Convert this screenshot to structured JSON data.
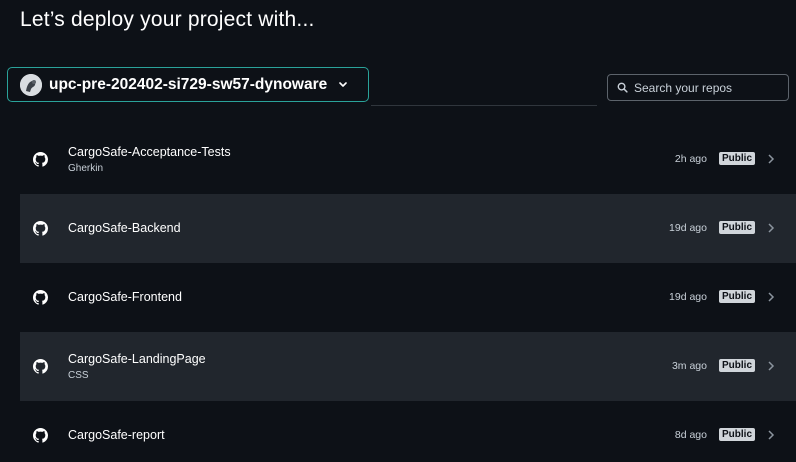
{
  "header": {
    "title": "Let’s deploy your project with..."
  },
  "account": {
    "name": "upc-pre-202402-si729-sw57-dynoware",
    "avatar_icon": "org-avatar",
    "dropdown_icon": "chevron-down-icon",
    "focus_color": "#2aa39a"
  },
  "search": {
    "placeholder": "Search your repos",
    "value": "",
    "icon": "search-icon"
  },
  "repos": [
    {
      "name": "CargoSafe-Acceptance-Tests",
      "language": "Gherkin",
      "updated": "2h ago",
      "visibility": "Public"
    },
    {
      "name": "CargoSafe-Backend",
      "language": "",
      "updated": "19d ago",
      "visibility": "Public"
    },
    {
      "name": "CargoSafe-Frontend",
      "language": "",
      "updated": "19d ago",
      "visibility": "Public"
    },
    {
      "name": "CargoSafe-LandingPage",
      "language": "CSS",
      "updated": "3m ago",
      "visibility": "Public"
    },
    {
      "name": "CargoSafe-report",
      "language": "",
      "updated": "8d ago",
      "visibility": "Public"
    }
  ],
  "colors": {
    "background": "#0d1117",
    "row_alt": "#21262d",
    "badge_bg": "#d0d5da"
  }
}
